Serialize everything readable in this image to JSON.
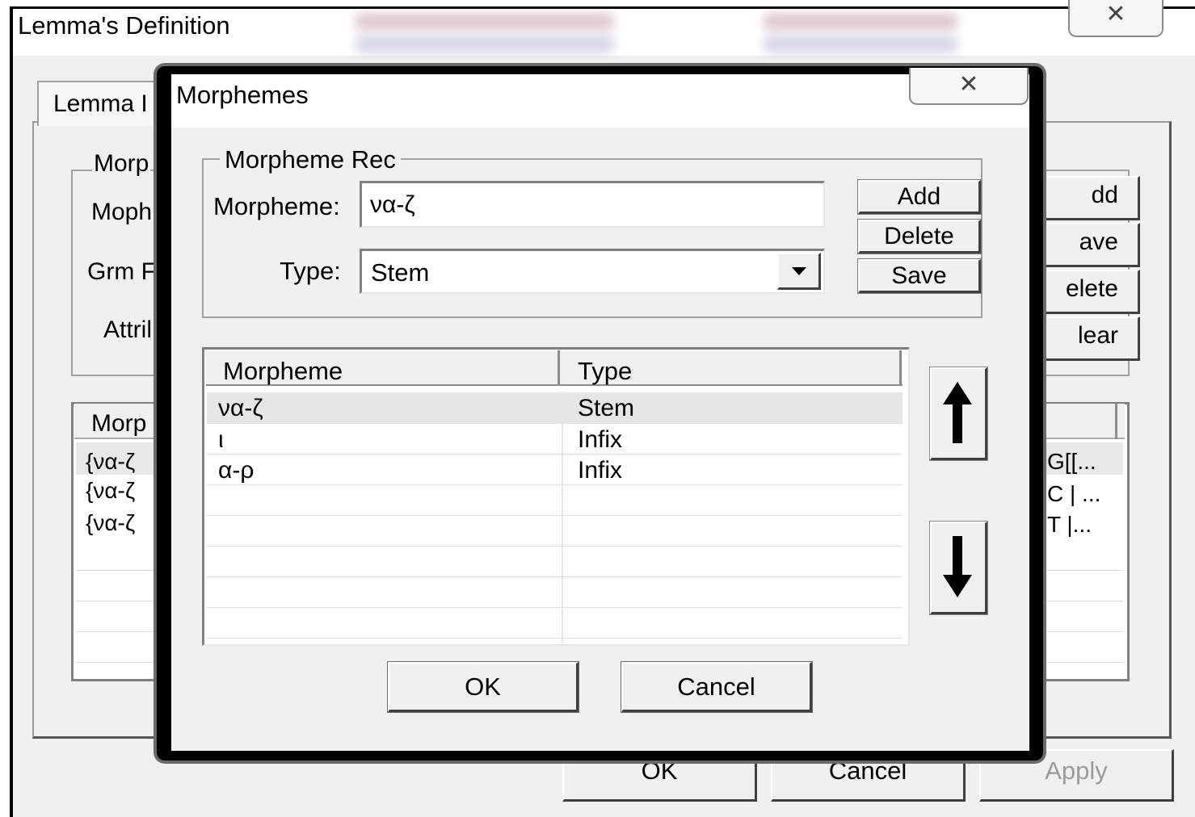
{
  "background_window": {
    "title": "Lemma's Definition",
    "close_glyph": "✕",
    "tab_label": "Lemma I",
    "labels": {
      "group_title": "Morp",
      "morpheme_row": "Moph",
      "grm_row": "Grm F",
      "attr_row": "Attril"
    },
    "side_buttons": [
      "dd",
      "ave",
      "elete",
      "lear"
    ],
    "list": {
      "header": "Morp",
      "rows_left": [
        "{να-ζ",
        "{να-ζ",
        "{να-ζ"
      ],
      "rows_right": [
        "G[[...",
        "C | ...",
        "T |..."
      ]
    },
    "bottom_buttons": {
      "ok": "OK",
      "cancel": "Cancel",
      "apply": "Apply"
    }
  },
  "dialog": {
    "title": "Morphemes",
    "close_glyph": "✕",
    "group_title": "Morpheme Rec",
    "morpheme_label": "Morpheme:",
    "morpheme_value": "να-ζ",
    "type_label": "Type:",
    "type_value": "Stem",
    "buttons": {
      "add": "Add",
      "delete": "Delete",
      "save": "Save"
    },
    "grid": {
      "columns": [
        "Morpheme",
        "Type"
      ],
      "rows": [
        {
          "morpheme": "να-ζ",
          "type": "Stem"
        },
        {
          "morpheme": "ι",
          "type": "Infix"
        },
        {
          "morpheme": "α-ρ",
          "type": "Infix"
        }
      ]
    },
    "move_up_icon": "arrow-up",
    "move_down_icon": "arrow-down",
    "ok_label": "OK",
    "cancel_label": "Cancel"
  }
}
